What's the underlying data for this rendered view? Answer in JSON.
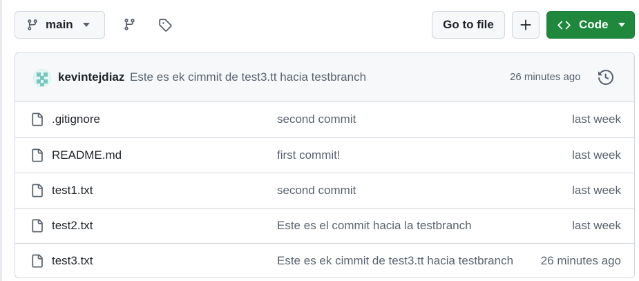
{
  "toolbar": {
    "branch_label": "main",
    "go_to_file_label": "Go to file",
    "add_label": "+",
    "code_label": "Code"
  },
  "latest_commit": {
    "author": "kevintejdiaz",
    "message": "Este es ek cimmit de test3.tt hacia testbranch",
    "time": "26 minutes ago"
  },
  "files": [
    {
      "name": ".gitignore",
      "message": "second commit",
      "time": "last week"
    },
    {
      "name": "README.md",
      "message": "first commit!",
      "time": "last week"
    },
    {
      "name": "test1.txt",
      "message": "second commit",
      "time": "last week"
    },
    {
      "name": "test2.txt",
      "message": "Este es el commit hacia la testbranch",
      "time": "last week"
    },
    {
      "name": "test3.txt",
      "message": "Este es ek cimmit de test3.tt hacia testbranch",
      "time": "26 minutes ago"
    }
  ],
  "colors": {
    "code_button": "#1f883d",
    "border": "#d0d7de",
    "muted_text": "#59636e",
    "header_bg": "#f6f8fa"
  },
  "icons": {
    "branch": "git-branch-icon",
    "tag": "tag-icon",
    "history": "history-icon",
    "file": "file-icon",
    "code": "code-icon",
    "caret": "triangle-down-icon"
  }
}
